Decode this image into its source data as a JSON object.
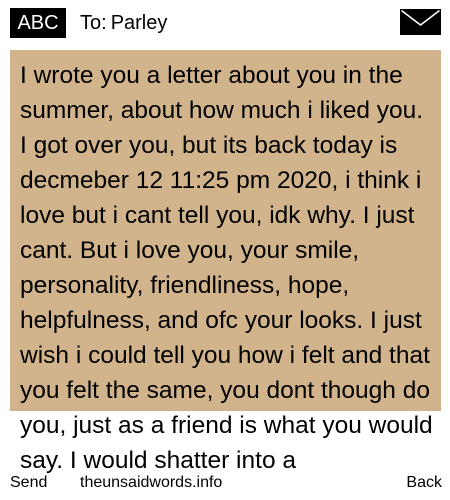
{
  "header": {
    "input_mode": "ABC",
    "recipient_prefix": "To:",
    "recipient_name": "Parley",
    "icon": "envelope-icon"
  },
  "message": {
    "text": "I wrote you a letter about you in the summer, about how much i liked you. I got over you, but its back today is decmeber 12 11:25 pm 2020, i think i love but i cant tell you, idk why. I just cant. But i love you, your smile, personality, friendliness, hope, helpfulness, and ofc your looks. I just wish i could tell you how i felt and that you felt the same, you dont though do you, just as a friend is what you would say. I would shatter into a"
  },
  "softkeys": {
    "left": "Send",
    "center": "theunsaidwords.info",
    "right": "Back"
  },
  "colors": {
    "message_background": "#d2b48c",
    "badge_background": "#000000",
    "text": "#000000"
  }
}
